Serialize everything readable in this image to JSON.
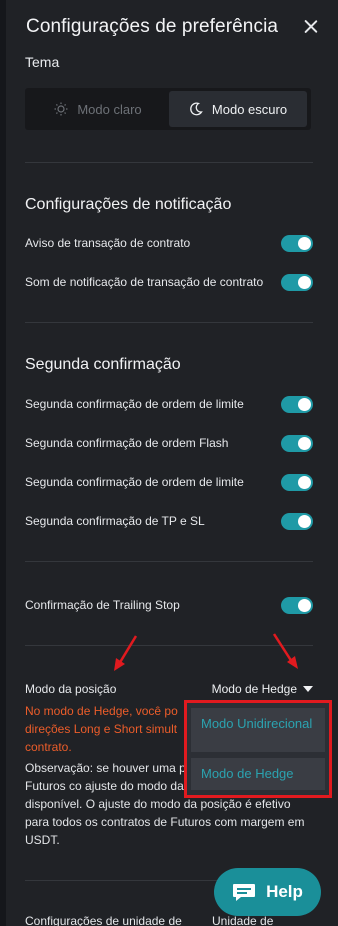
{
  "header": {
    "title": "Configurações de preferência"
  },
  "theme": {
    "label": "Tema",
    "options": [
      {
        "label": "Modo claro",
        "icon": "sun-icon",
        "selected": false
      },
      {
        "label": "Modo escuro",
        "icon": "moon-icon",
        "selected": true
      }
    ]
  },
  "notifications": {
    "title": "Configurações de notificação",
    "items": [
      {
        "label": "Aviso de transação de contrato",
        "enabled": true
      },
      {
        "label": "Som de notificação de transação de contrato",
        "enabled": true
      }
    ]
  },
  "confirmation": {
    "title": "Segunda confirmação",
    "items": [
      {
        "label": "Segunda confirmação de ordem de limite",
        "enabled": true
      },
      {
        "label": "Segunda confirmação de ordem Flash",
        "enabled": true
      },
      {
        "label": "Segunda confirmação de ordem de limite",
        "enabled": true
      },
      {
        "label": "Segunda confirmação de TP e SL",
        "enabled": true
      }
    ]
  },
  "trailing": {
    "label": "Confirmação de Trailing Stop",
    "enabled": true
  },
  "position": {
    "label": "Modo da posição",
    "selected": "Modo de Hedge",
    "warning": "No modo de Hedge, você po direções Long e Short simult contrato.",
    "note": "Observação: se houver uma p pendente em seus Futuros co ajuste do modo da posição não estará disponível. O ajuste do modo da posição é efetivo para todos os contratos de Futuros com margem em USDT.",
    "options": [
      "Modo Unidirecional",
      "Modo de Hedge"
    ]
  },
  "help": {
    "label": "Help"
  },
  "bottom": {
    "left": "Configurações de unidade de",
    "right": "Unidade de"
  },
  "colors": {
    "accent": "#1f9aa6",
    "warning": "#ec5d2a",
    "highlight": "#e11a1f",
    "help": "#1a8f99"
  }
}
